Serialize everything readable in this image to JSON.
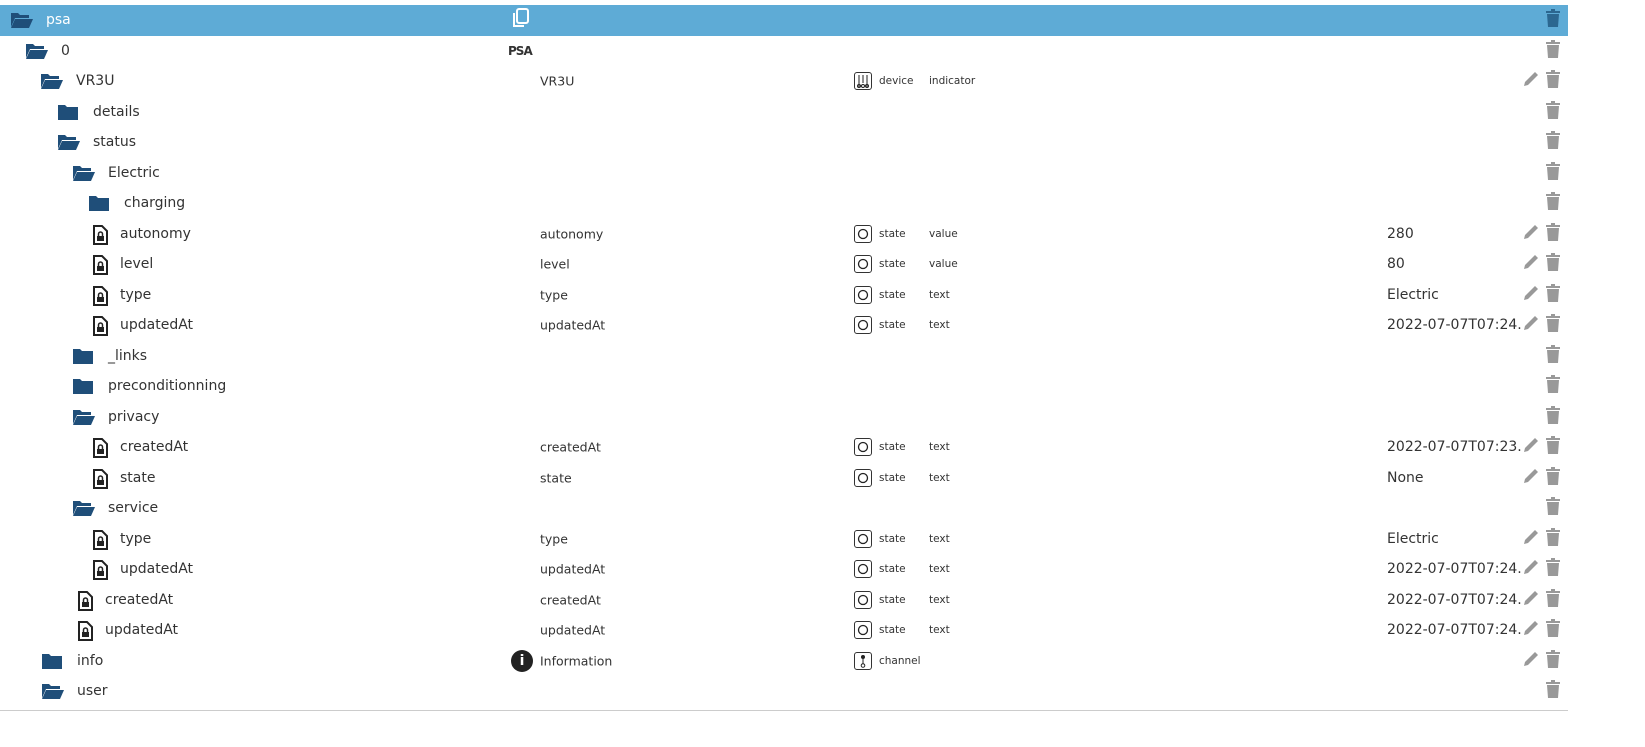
{
  "colors": {
    "selected_row": "#5eabd6",
    "folder": "#1f4e79",
    "icon_gray": "#999999"
  },
  "rows": [
    {
      "name": "psa",
      "icon": "folder-open",
      "indent": 10,
      "selected": true,
      "copy": true
    },
    {
      "name": "0",
      "icon": "folder-open",
      "indent": 25,
      "logo": "PSA"
    },
    {
      "name": "VR3U",
      "icon": "folder-open",
      "indent": 40,
      "col2": "VR3U",
      "type": "device",
      "role": "indicator",
      "edit": true
    },
    {
      "name": "details",
      "icon": "folder",
      "indent": 57
    },
    {
      "name": "status",
      "icon": "folder-open",
      "indent": 57
    },
    {
      "name": "Electric",
      "icon": "folder-open",
      "indent": 72
    },
    {
      "name": "charging",
      "icon": "folder",
      "indent": 88
    },
    {
      "name": "autonomy",
      "icon": "file",
      "indent": 92,
      "col2": "autonomy",
      "type": "state",
      "role": "value",
      "value": "280",
      "edit": true
    },
    {
      "name": "level",
      "icon": "file",
      "indent": 92,
      "col2": "level",
      "type": "state",
      "role": "value",
      "value": "80",
      "edit": true
    },
    {
      "name": "type",
      "icon": "file",
      "indent": 92,
      "col2": "type",
      "type": "state",
      "role": "text",
      "value": "Electric",
      "edit": true
    },
    {
      "name": "updatedAt",
      "icon": "file",
      "indent": 92,
      "col2": "updatedAt",
      "type": "state",
      "role": "text",
      "value": "2022-07-07T07:24...",
      "edit": true
    },
    {
      "name": "_links",
      "icon": "folder",
      "indent": 72
    },
    {
      "name": "preconditionning",
      "icon": "folder",
      "indent": 72
    },
    {
      "name": "privacy",
      "icon": "folder-open",
      "indent": 72
    },
    {
      "name": "createdAt",
      "icon": "file",
      "indent": 92,
      "col2": "createdAt",
      "type": "state",
      "role": "text",
      "value": "2022-07-07T07:23...",
      "edit": true
    },
    {
      "name": "state",
      "icon": "file",
      "indent": 92,
      "col2": "state",
      "type": "state",
      "role": "text",
      "value": "None",
      "edit": true
    },
    {
      "name": "service",
      "icon": "folder-open",
      "indent": 72
    },
    {
      "name": "type",
      "icon": "file",
      "indent": 92,
      "col2": "type",
      "type": "state",
      "role": "text",
      "value": "Electric",
      "edit": true
    },
    {
      "name": "updatedAt",
      "icon": "file",
      "indent": 92,
      "col2": "updatedAt",
      "type": "state",
      "role": "text",
      "value": "2022-07-07T07:24...",
      "edit": true
    },
    {
      "name": "createdAt",
      "icon": "file",
      "indent": 77,
      "col2": "createdAt",
      "type": "state",
      "role": "text",
      "value": "2022-07-07T07:24...",
      "edit": true
    },
    {
      "name": "updatedAt",
      "icon": "file",
      "indent": 77,
      "col2": "updatedAt",
      "type": "state",
      "role": "text",
      "value": "2022-07-07T07:24...",
      "edit": true
    },
    {
      "name": "info",
      "icon": "folder",
      "indent": 41,
      "col2": "Information",
      "col2icon": "info",
      "type": "channel",
      "edit": true
    },
    {
      "name": "user",
      "icon": "folder-open",
      "indent": 41
    }
  ]
}
